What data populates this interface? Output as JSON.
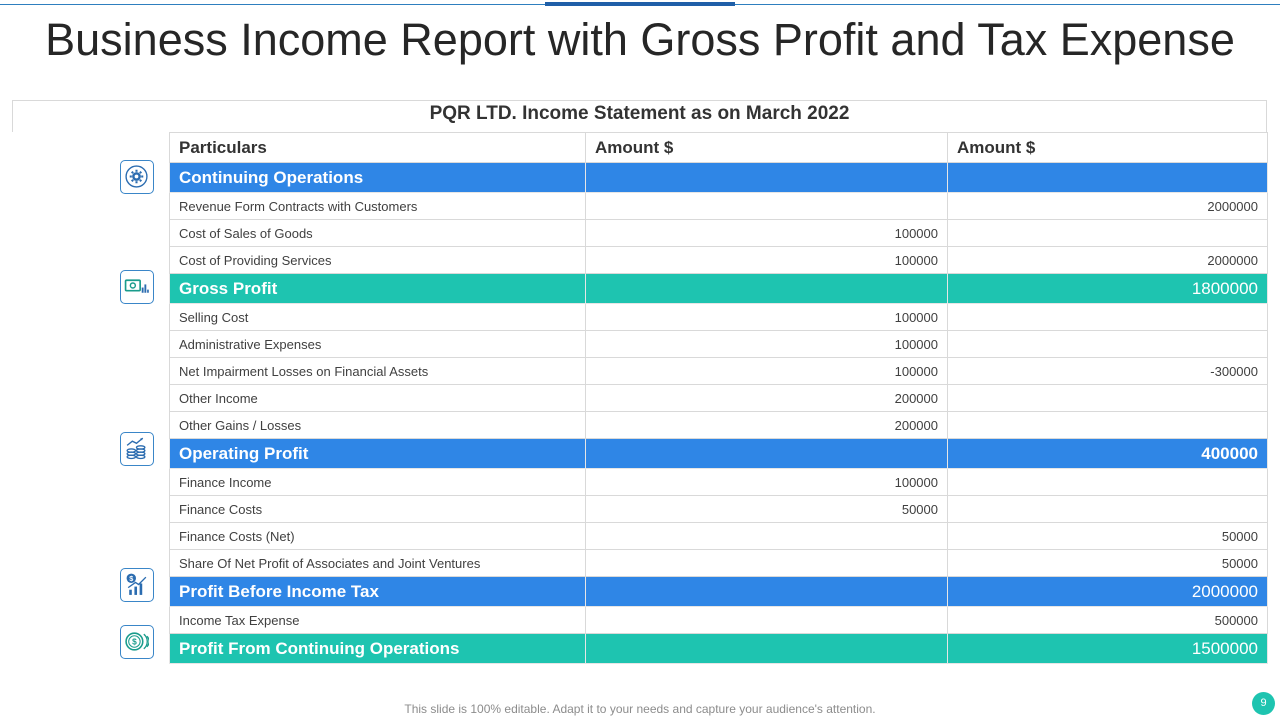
{
  "page": {
    "title": "Business Income Report with Gross Profit and Tax Expense",
    "footer_note": "This slide is 100% editable. Adapt it to your needs and capture your audience's attention.",
    "page_number": "9"
  },
  "statement": {
    "title": "PQR LTD. Income Statement as on March 2022",
    "headers": [
      "Particulars",
      "Amount $",
      "Amount $"
    ],
    "rows": [
      {
        "type": "section",
        "color": "blue",
        "label": "Continuing Operations",
        "amount1": "",
        "amount2": ""
      },
      {
        "type": "item",
        "label": "Revenue  Form Contracts with Customers",
        "amount1": "",
        "amount2": "2000000"
      },
      {
        "type": "item",
        "label": "Cost of Sales of Goods",
        "amount1": "100000",
        "amount2": ""
      },
      {
        "type": "item",
        "label": "Cost of Providing  Services",
        "amount1": "100000",
        "amount2": "2000000"
      },
      {
        "type": "section",
        "color": "teal",
        "label": "Gross  Profit",
        "amount1": "",
        "amount2": "1800000"
      },
      {
        "type": "item",
        "label": "Selling Cost",
        "amount1": "100000",
        "amount2": ""
      },
      {
        "type": "item",
        "label": "Administrative  Expenses",
        "amount1": "100000",
        "amount2": ""
      },
      {
        "type": "item",
        "label": "Net Impairment  Losses on Financial Assets",
        "amount1": "100000",
        "amount2": "-300000"
      },
      {
        "type": "item",
        "label": "Other Income",
        "amount1": "200000",
        "amount2": ""
      },
      {
        "type": "item",
        "label": "Other Gains / Losses",
        "amount1": "200000",
        "amount2": ""
      },
      {
        "type": "section",
        "color": "blue",
        "label": "Operating Profit",
        "amount1": "",
        "amount2": "400000"
      },
      {
        "type": "item",
        "label": "Finance Income",
        "amount1": "100000",
        "amount2": ""
      },
      {
        "type": "item",
        "label": "Finance Costs",
        "amount1": "50000",
        "amount2": ""
      },
      {
        "type": "item",
        "label": "Finance Costs (Net)",
        "amount1": "",
        "amount2": "50000"
      },
      {
        "type": "item",
        "label": "Share Of Net Profit of Associates and Joint Ventures",
        "amount1": "",
        "amount2": "50000"
      },
      {
        "type": "section",
        "color": "blue",
        "label": "Profit Before Income Tax",
        "amount1": "",
        "amount2": "2000000"
      },
      {
        "type": "item",
        "label": "Income Tax Expense",
        "amount1": "",
        "amount2": "500000"
      },
      {
        "type": "section",
        "color": "teal",
        "label": "Profit From Continuing Operations",
        "amount1": "",
        "amount2": "1500000"
      }
    ]
  },
  "icons": [
    {
      "name": "gear-icon"
    },
    {
      "name": "cash-icon"
    },
    {
      "name": "coins-growth-icon"
    },
    {
      "name": "dollar-chart-icon"
    },
    {
      "name": "coin-icon"
    }
  ],
  "colors": {
    "blue": "#2f86e6",
    "teal": "#1ec4b0",
    "icon_border": "#3a86c8"
  }
}
